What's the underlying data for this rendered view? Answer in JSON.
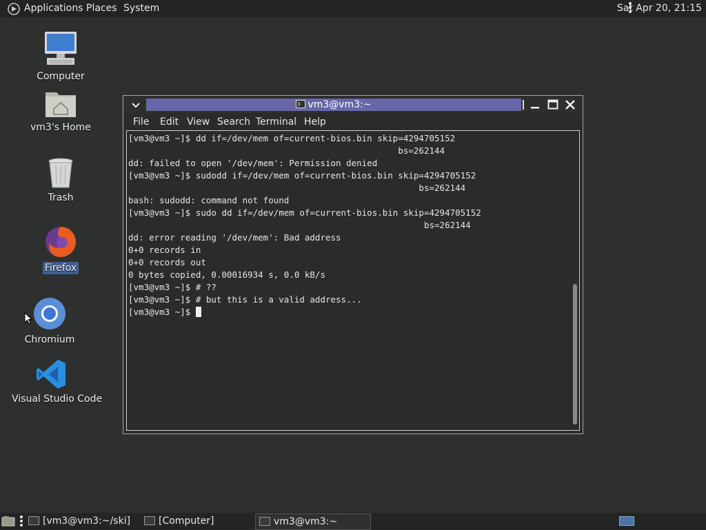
{
  "top_panel": {
    "menus": [
      "Applications",
      "Places",
      "System"
    ],
    "clock": "Sat Apr 20, 21:15"
  },
  "desktop": {
    "icons": [
      {
        "label": "Computer"
      },
      {
        "label": "vm3's Home"
      },
      {
        "label": "Trash"
      },
      {
        "label": "Firefox"
      },
      {
        "label": "Chromium"
      },
      {
        "label": "Visual Studio Code"
      }
    ]
  },
  "terminal": {
    "title": "vm3@vm3:~",
    "menus": [
      "File",
      "Edit",
      "View",
      "Search",
      "Terminal",
      "Help"
    ],
    "lines": [
      "[vm3@vm3 ~]$ dd if=/dev/mem of=current-bios.bin skip=4294705152",
      "                                                    bs=262144",
      "dd: failed to open '/dev/mem': Permission denied",
      "[vm3@vm3 ~]$ sudodd if=/dev/mem of=current-bios.bin skip=4294705152",
      "                                                        bs=262144",
      "bash: sudodd: command not found",
      "[vm3@vm3 ~]$ sudo dd if=/dev/mem of=current-bios.bin skip=4294705152",
      "                                                         bs=262144",
      "dd: error reading '/dev/mem': Bad address",
      "0+0 records in",
      "0+0 records out",
      "0 bytes copied, 0.00016934 s, 0.0 kB/s",
      "[vm3@vm3 ~]$ # ??",
      "[vm3@vm3 ~]$ # but this is a valid address..."
    ],
    "prompt": "[vm3@vm3 ~]$ "
  },
  "taskbar": {
    "tasks": [
      {
        "label": "[vm3@vm3:~/ski]"
      },
      {
        "label": "[Computer]"
      },
      {
        "label": "vm3@vm3:~"
      }
    ]
  },
  "colors": {
    "desktop_bg": "#2e3030",
    "title_highlight": "#6667a8",
    "selection": "#3f5f8f"
  }
}
